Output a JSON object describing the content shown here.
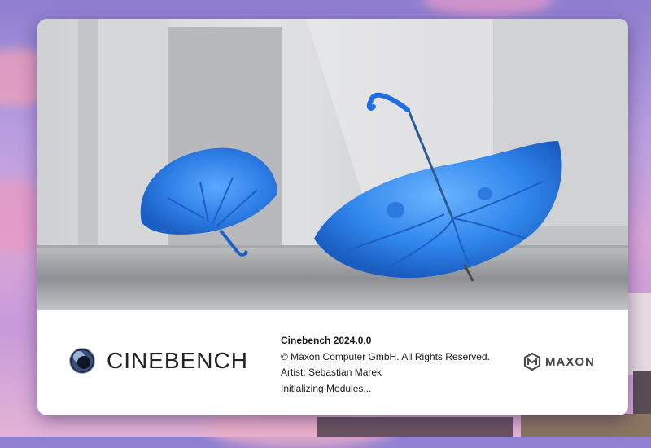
{
  "product": {
    "logo_text": "CINEBENCH",
    "version_line": "Cinebench 2024.0.0",
    "copyright": "© Maxon Computer GmbH. All Rights Reserved.",
    "artist": "Artist: Sebastian Marek",
    "status": "Initializing Modules..."
  },
  "brand": {
    "name": "MAXON"
  },
  "colors": {
    "umbrella_blue": "#2f7fe0",
    "text": "#1a1a1a"
  }
}
